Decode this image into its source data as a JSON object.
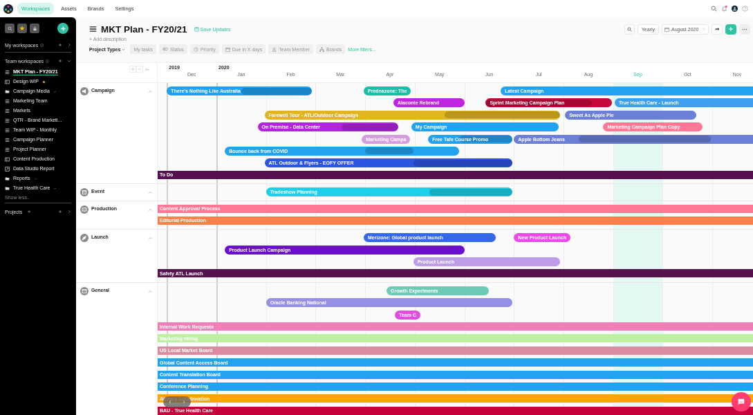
{
  "top_nav": {
    "tabs": [
      {
        "label": "Workspaces",
        "selected": true
      },
      {
        "label": "Assets",
        "selected": false
      },
      {
        "label": "Brands",
        "selected": false
      },
      {
        "label": "Settings",
        "selected": false
      }
    ],
    "notifications_unread": true
  },
  "sidebar": {
    "my_workspaces": "My workspaces",
    "team_workspaces": "Team workspaces",
    "items": [
      {
        "label": "MKT Plan - FY20/21",
        "kind": "list",
        "selected": true,
        "starred": false
      },
      {
        "label": "Design WIP",
        "kind": "board",
        "selected": false,
        "starred": true
      },
      {
        "label": "Campaign Media",
        "kind": "folder",
        "selected": false,
        "starred": false
      },
      {
        "label": "Marketing Team",
        "kind": "list",
        "selected": false,
        "starred": false
      },
      {
        "label": "Markets",
        "kind": "list",
        "selected": false,
        "starred": false
      },
      {
        "label": "QTR - Brand Marketi...",
        "kind": "list",
        "selected": false,
        "starred": false
      },
      {
        "label": "Team WIP - Monthly",
        "kind": "list",
        "selected": false,
        "starred": false
      },
      {
        "label": "Campaign Planner",
        "kind": "list",
        "selected": false,
        "starred": false
      },
      {
        "label": "Project Planner",
        "kind": "list",
        "selected": false,
        "starred": false
      },
      {
        "label": "Content Production",
        "kind": "board",
        "selected": false,
        "starred": false
      },
      {
        "label": "Data Studio Report",
        "kind": "report",
        "selected": false,
        "starred": false
      },
      {
        "label": "Reports",
        "kind": "folder",
        "selected": false,
        "starred": false
      },
      {
        "label": "True Health Care",
        "kind": "folder",
        "selected": false,
        "starred": false
      }
    ],
    "show_less": "Show less..",
    "projects": "Projects"
  },
  "header": {
    "title": "MKT Plan - FY20/21",
    "save": "Save Updates",
    "add_description": "+ Add description",
    "project_types": "Project Types",
    "filters": [
      {
        "label": "My tasks",
        "kind": "plain"
      },
      {
        "label": "Status",
        "kind": "status"
      },
      {
        "label": "Priority",
        "kind": "priority"
      },
      {
        "label": "Due in X days",
        "kind": "date"
      },
      {
        "label": "Team Member",
        "kind": "person"
      },
      {
        "label": "Brands",
        "kind": "brands"
      }
    ],
    "more_filters": "More filters...",
    "view": "Yearly",
    "date": "August 2020"
  },
  "timeline": {
    "months": [
      {
        "label": "Dec",
        "year": "2019",
        "selected": false
      },
      {
        "label": "Jan",
        "year": "2020",
        "selected": false
      },
      {
        "label": "Feb",
        "selected": false
      },
      {
        "label": "Mar",
        "selected": false
      },
      {
        "label": "Apr",
        "selected": false
      },
      {
        "label": "May",
        "selected": false
      },
      {
        "label": "Jun",
        "selected": false
      },
      {
        "label": "Jul",
        "selected": false
      },
      {
        "label": "Aug",
        "selected": false
      },
      {
        "label": "Sep",
        "selected": true
      },
      {
        "label": "Oct",
        "selected": false
      },
      {
        "label": "Nov",
        "selected": false
      }
    ],
    "groups": [
      {
        "name": "Campaign",
        "kind": "megaphone",
        "expanded": true,
        "lanes": [
          [
            {
              "label": "There's Nothing Like Australia",
              "kind": "task",
              "color": "#1ea1f1"
            },
            {
              "label": "Prednazone: The",
              "kind": "task",
              "color": "#1bbfa6"
            },
            {
              "label": "Latest Campaign",
              "kind": "task",
              "color": "#22a3f0"
            }
          ],
          [
            {
              "label": "Alaconte Rebrand",
              "kind": "task",
              "color": "#c223e0"
            },
            {
              "label": "Sprint Marketing Campaign Plan",
              "kind": "task",
              "color": "#c8073c"
            },
            {
              "label": "True Health Care - Launch",
              "kind": "task",
              "color": "#3e9ff0"
            }
          ],
          [
            {
              "label": "Farewell Tour - ATL/Outdoor Campaign",
              "kind": "task",
              "color": "#e0b521"
            },
            {
              "label": "Sweet As Apple Pie",
              "kind": "task",
              "color": "#6b7fd6"
            }
          ],
          [
            {
              "label": "On Premise - Data Center",
              "kind": "task",
              "color": "#b026db"
            },
            {
              "label": "My Campaign",
              "kind": "task",
              "color": "#22a3f0"
            },
            {
              "label": "Marketing Campaign Plan Copy",
              "kind": "task",
              "color": "#ff7896"
            }
          ],
          [
            {
              "label": "Marketing Campa",
              "kind": "task",
              "color": "#d79be0"
            },
            {
              "label": "Free Tafe Course Promo",
              "kind": "task",
              "color": "#22a3f0"
            },
            {
              "label": "Apple Bottom Jeans",
              "kind": "task",
              "color": "#6b7fd6"
            }
          ],
          [
            {
              "label": "Bounce back from COVID",
              "kind": "task",
              "color": "#22a3f0"
            }
          ],
          [
            {
              "label": "ATL Outdoor & Flyers - EOFY OFFER",
              "kind": "task",
              "color": "#2d55e0"
            }
          ],
          [
            {
              "label": "To Do",
              "kind": "band",
              "color": "#55124f"
            }
          ]
        ]
      },
      {
        "name": "Event",
        "kind": "calendar",
        "expanded": true,
        "lanes": [
          [
            {
              "label": "Tradeshow Planning",
              "kind": "task",
              "color": "#1ecfea"
            }
          ]
        ]
      },
      {
        "name": "Production",
        "kind": "image",
        "expanded": true,
        "lanes": [
          [
            {
              "label": "Content Approval Process",
              "kind": "band",
              "color": "#ff7896"
            }
          ],
          [
            {
              "label": "Editorial Production",
              "kind": "band",
              "color": "#ff8048"
            }
          ]
        ]
      },
      {
        "name": "Launch",
        "kind": "rocket",
        "expanded": true,
        "lanes": [
          [
            {
              "label": "Merizone: Global product launch",
              "kind": "task",
              "color": "#3468e8"
            },
            {
              "label": "New Product Launch",
              "kind": "task",
              "color": "#e94ae8"
            }
          ],
          [
            {
              "label": "Product Launch Campaign",
              "kind": "task",
              "color": "#6b0ecf"
            }
          ],
          [
            {
              "label": "Product Launch",
              "kind": "task",
              "color": "#bd9de8"
            }
          ],
          [
            {
              "label": "Safety ATL Launch",
              "kind": "band",
              "color": "#55124f"
            }
          ]
        ]
      },
      {
        "name": "General",
        "kind": "window",
        "expanded": true,
        "lanes": [
          [
            {
              "label": "Growth Experiments",
              "kind": "task",
              "color": "#6ccab6"
            }
          ],
          [
            {
              "label": "Oracle Banking National",
              "kind": "task",
              "color": "#9590e6"
            }
          ],
          [
            {
              "label": "Team C",
              "kind": "task",
              "color": "#e04ee0"
            }
          ],
          [
            {
              "label": "Internal Work Requests",
              "kind": "band",
              "color": "#f07fb6"
            }
          ],
          [
            {
              "label": "Marketing Hiring",
              "kind": "band",
              "color": "#bdf0a0"
            }
          ],
          [
            {
              "label": "US Local Market Board",
              "kind": "band",
              "color": "#db8ba0"
            }
          ],
          [
            {
              "label": "Global Content Access Board",
              "kind": "band",
              "color": "#22a3f0"
            }
          ],
          [
            {
              "label": "Content Translation Board",
              "kind": "band",
              "color": "#22a3f0"
            }
          ],
          [
            {
              "label": "Conference Planning",
              "kind": "band",
              "color": "#22a3f0"
            }
          ],
          [
            {
              "label": "Agency Collaboration",
              "kind": "band",
              "color": "#ffa400"
            }
          ],
          [
            {
              "label": "BAU - True Health Care",
              "kind": "band",
              "color": "#c6003a"
            }
          ]
        ]
      }
    ]
  }
}
